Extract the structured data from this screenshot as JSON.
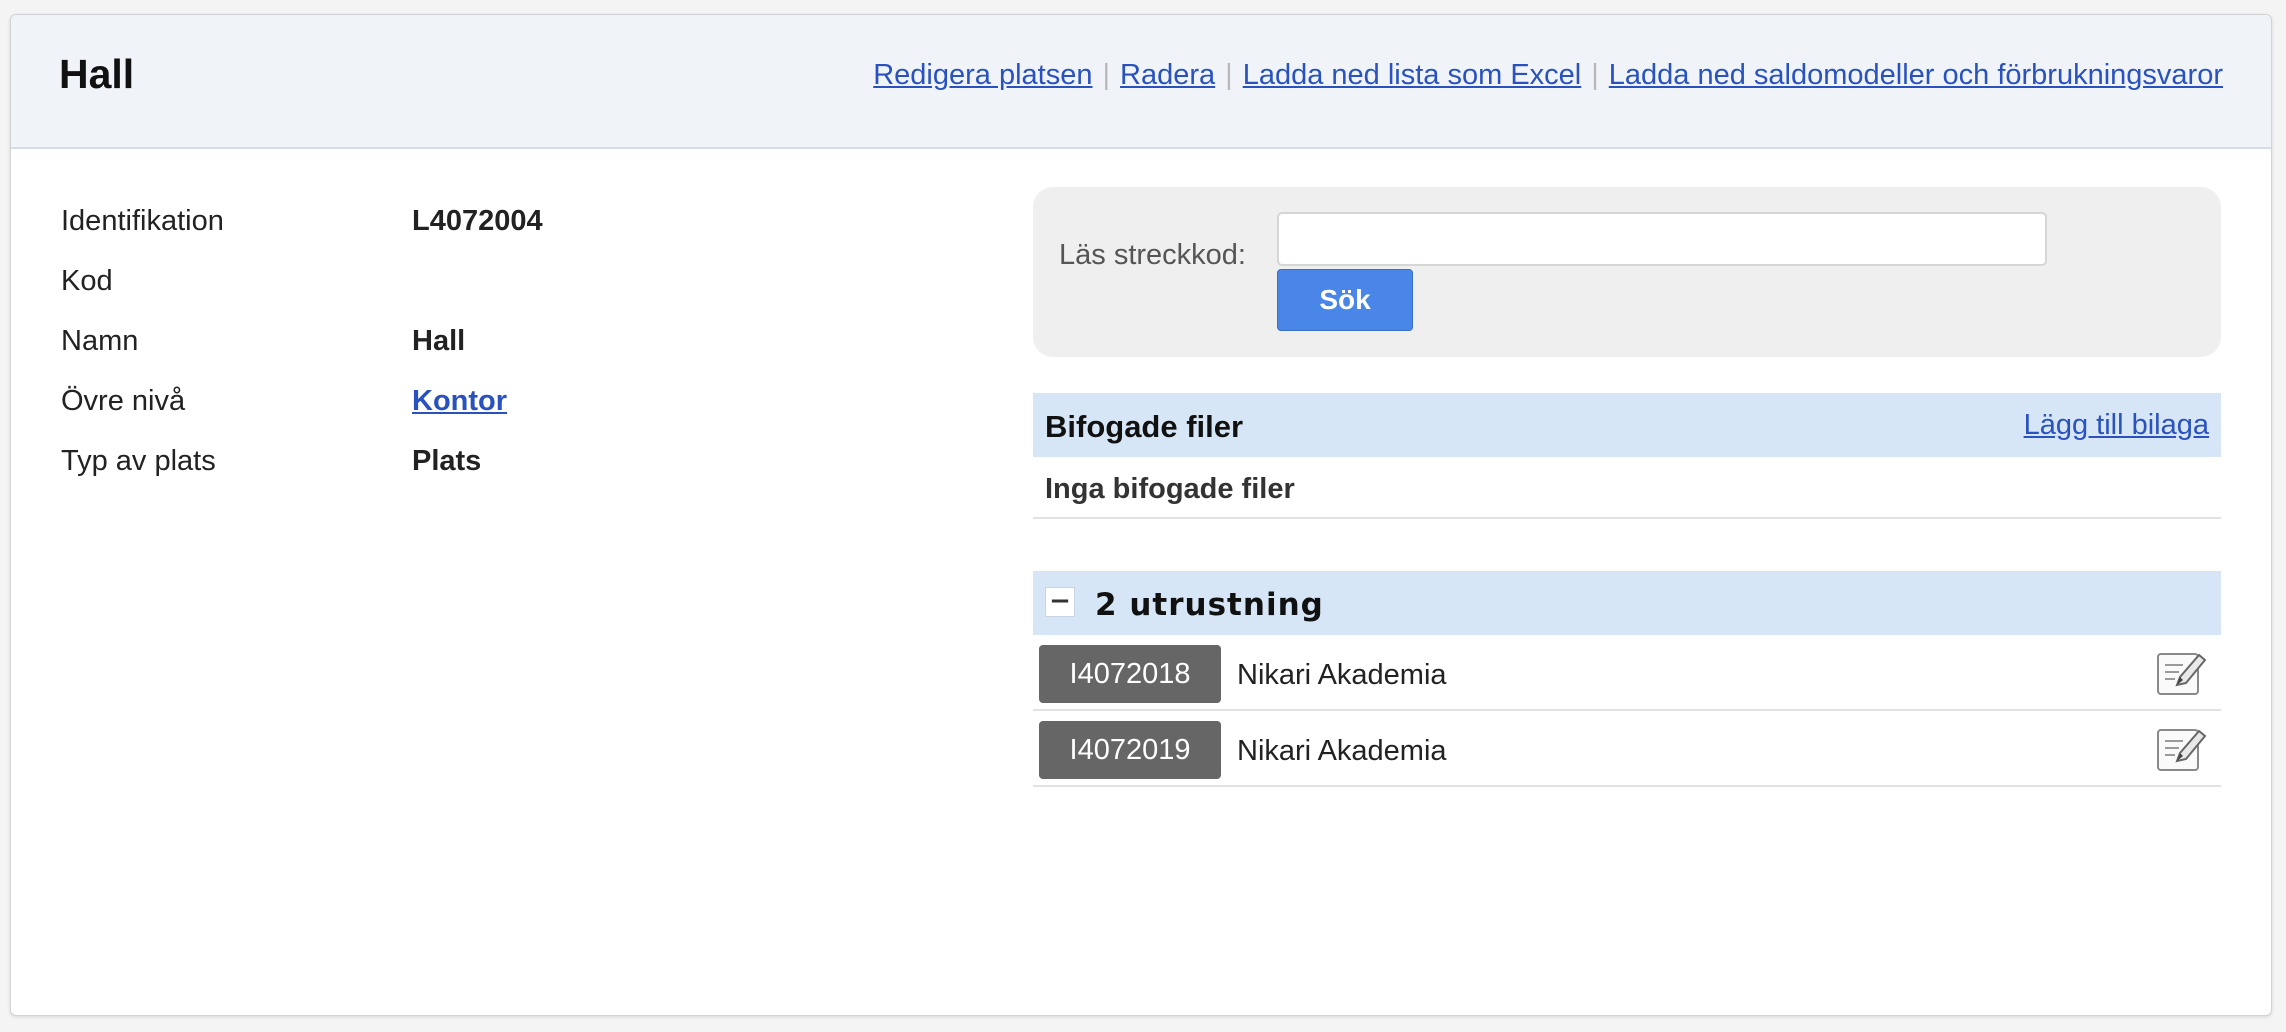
{
  "header": {
    "title": "Hall",
    "actions": {
      "edit": "Redigera platsen",
      "delete": "Radera",
      "download_excel": "Ladda ned lista som Excel",
      "download_models": "Ladda ned saldomodeller och förbrukningsvaror",
      "separator": "|"
    }
  },
  "info": {
    "rows": [
      {
        "label": "Identifikation",
        "value": "L4072004"
      },
      {
        "label": "Kod",
        "value": ""
      },
      {
        "label": "Namn",
        "value": "Hall"
      },
      {
        "label": "Övre nivå",
        "value": "Kontor"
      },
      {
        "label": "Typ av plats",
        "value": "Plats"
      }
    ]
  },
  "barcode": {
    "label": "Läs streckkod:",
    "input_value": "",
    "input_placeholder": "",
    "search_label": "Sök"
  },
  "attachments": {
    "title": "Bifogade filer",
    "add_label": "Lägg till bilaga",
    "empty_text": "Inga bifogade filer"
  },
  "equipment": {
    "collapse_symbol": "−",
    "title": "2 utrustning",
    "items": [
      {
        "id": "I4072018",
        "name": "Nikari Akademia"
      },
      {
        "id": "I4072019",
        "name": "Nikari Akademia"
      }
    ]
  },
  "colors": {
    "link": "#2a52be",
    "header_bg": "#f0f4f8",
    "section_bg": "#d7e6f6",
    "button": "#4a86e8",
    "id_badge": "#666666"
  },
  "icons": {
    "edit": "edit-pencil-icon",
    "collapse": "minus-icon"
  }
}
